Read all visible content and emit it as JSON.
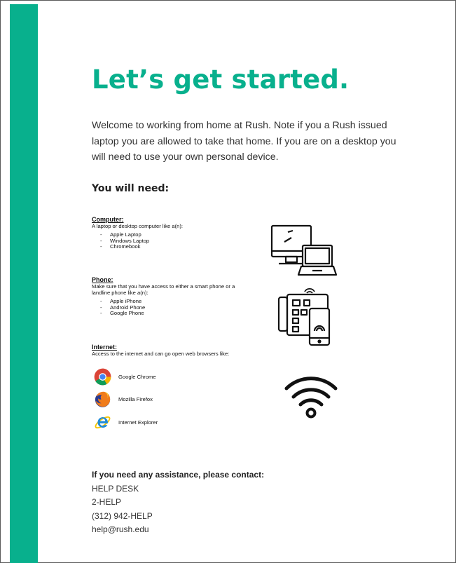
{
  "colors": {
    "accent": "#08b08d",
    "text": "#333333"
  },
  "title": "Let’s get started.",
  "intro": "Welcome to working from home at Rush. Note if you a Rush issued laptop you are allowed to take that home. If you are on a desktop you will need to use your own personal device.",
  "need_heading": "You will need:",
  "computer": {
    "heading": "Computer:",
    "desc": "A laptop or desktop computer like a(n):",
    "items": [
      "Apple Laptop",
      "Windows Laptop",
      "Chromebook"
    ],
    "icon": "computer-laptop-icon"
  },
  "phone": {
    "heading": "Phone:",
    "desc_1": "Make sure that you have access to either a smart phone or a",
    "desc_2": "landline phone like a(n):",
    "items": [
      "Apple iPhone",
      "Android Phone",
      "Google Phone"
    ],
    "icon": "phone-icon"
  },
  "internet": {
    "heading": "Internet:",
    "desc": "Access to the internet and can go open web browsers like:",
    "browsers": [
      {
        "name": "Google Chrome",
        "icon": "chrome-icon"
      },
      {
        "name": "Mozilla Firefox",
        "icon": "firefox-icon"
      },
      {
        "name": "Internet Explorer",
        "icon": "internet-explorer-icon"
      }
    ],
    "icon": "wifi-icon"
  },
  "contact": {
    "heading": "If you need any assistance, please contact:",
    "lines": [
      "HELP DESK",
      "2-HELP",
      "(312) 942-HELP",
      "help@rush.edu"
    ]
  }
}
